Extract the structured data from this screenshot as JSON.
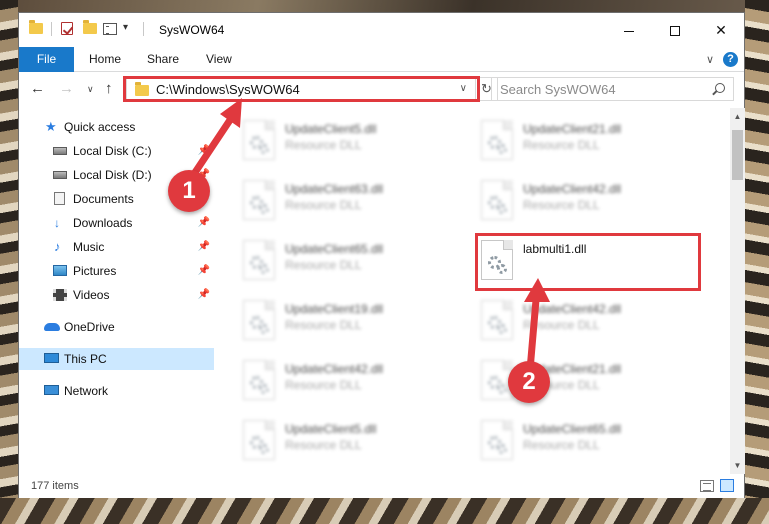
{
  "window": {
    "title": "SysWOW64",
    "qa_dropdown": "▾"
  },
  "ribbon": {
    "tabs": [
      "File",
      "Home",
      "Share",
      "View"
    ],
    "chevron": "∨",
    "help": "?"
  },
  "nav": {
    "back": "←",
    "forward": "→",
    "recent": "∨",
    "up": "↑"
  },
  "address": {
    "path": "C:\\Windows\\SysWOW64",
    "dropdown": "∨",
    "refresh": "↻"
  },
  "search": {
    "placeholder": "Search SysWOW64"
  },
  "sidebar": {
    "items": [
      {
        "label": "Quick access",
        "icon": "star-icon"
      },
      {
        "label": "Local Disk (C:)",
        "icon": "disk-icon",
        "pinned": true
      },
      {
        "label": "Local Disk (D:)",
        "icon": "disk-icon",
        "pinned": true
      },
      {
        "label": "Documents",
        "icon": "documents-icon",
        "pinned": true
      },
      {
        "label": "Downloads",
        "icon": "downloads-icon",
        "pinned": true
      },
      {
        "label": "Music",
        "icon": "music-icon",
        "pinned": true
      },
      {
        "label": "Pictures",
        "icon": "pictures-icon",
        "pinned": true
      },
      {
        "label": "Videos",
        "icon": "videos-icon",
        "pinned": true
      },
      {
        "label": "OneDrive",
        "icon": "onedrive-icon"
      },
      {
        "label": "This PC",
        "icon": "this-pc-icon",
        "selected": true
      },
      {
        "label": "Network",
        "icon": "network-icon"
      }
    ]
  },
  "files": [
    {
      "name": "UpdateClient5.dll",
      "type": "Resource DLL"
    },
    {
      "name": "UpdateClient21.dll",
      "type": "Resource DLL"
    },
    {
      "name": "UpdateClient63.dll",
      "type": "Resource DLL"
    },
    {
      "name": "UpdateClient42.dll",
      "type": "Resource DLL"
    },
    {
      "name": "UpdateClient65.dll",
      "type": "Resource DLL"
    },
    {
      "name": "labmulti1.dll",
      "type": "",
      "highlighted": true
    },
    {
      "name": "UpdateClient19.dll",
      "type": "Resource DLL"
    },
    {
      "name": "UpdateClient42.dll",
      "type": "Resource DLL"
    },
    {
      "name": "UpdateClient42.dll",
      "type": "Resource DLL"
    },
    {
      "name": "UpdateClient21.dll",
      "type": "Resource DLL"
    },
    {
      "name": "UpdateClient5.dll",
      "type": "Resource DLL"
    },
    {
      "name": "UpdateClient65.dll",
      "type": "Resource DLL"
    }
  ],
  "status": {
    "item_count": "177 items"
  },
  "markers": {
    "one": "1",
    "two": "2"
  },
  "colors": {
    "accent": "#1979ca",
    "highlight": "#e0393e",
    "selected_bg": "#cce8ff"
  }
}
